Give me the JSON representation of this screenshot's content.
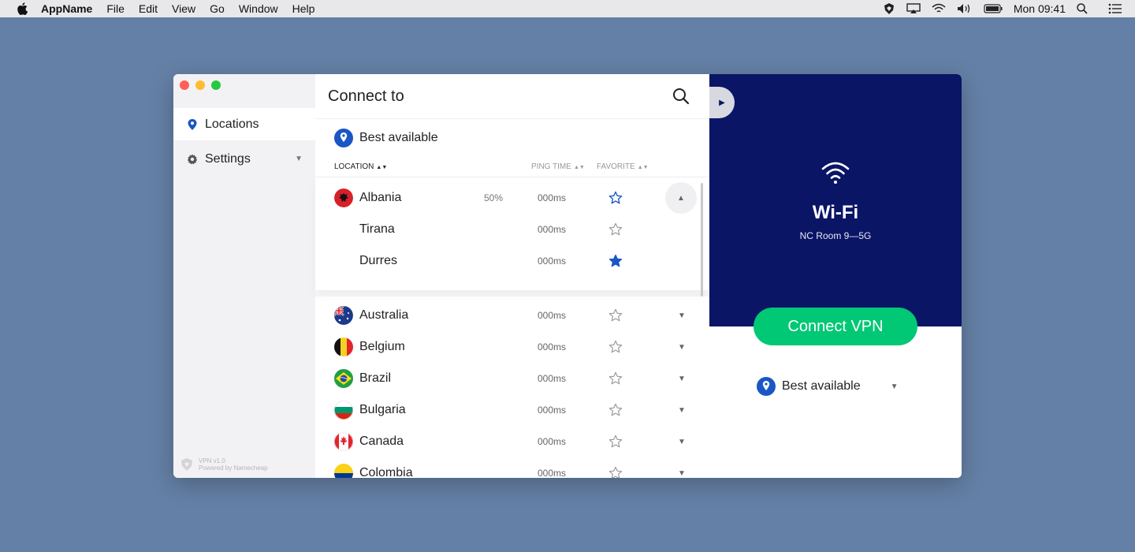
{
  "menubar": {
    "app_name": "AppName",
    "menus": [
      "File",
      "Edit",
      "View",
      "Go",
      "Window",
      "Help"
    ],
    "clock": "Mon 09:41"
  },
  "sidebar": {
    "items": [
      {
        "label": "Locations",
        "icon": "location-pin-icon",
        "active": true
      },
      {
        "label": "Settings",
        "icon": "gear-icon",
        "active": false
      }
    ],
    "brand_line1": "VPN v1.0",
    "brand_line2": "Powered by Namecheap"
  },
  "main": {
    "title": "Connect to",
    "best_available": "Best available",
    "columns": {
      "location": "LOCATION",
      "ping": "PING TIME",
      "favorite": "FAVORITE"
    },
    "expanded_country": {
      "name": "Albania",
      "load": "50%",
      "ping": "000ms",
      "favorite": false,
      "cities": [
        {
          "name": "Tirana",
          "ping": "000ms",
          "favorite": false
        },
        {
          "name": "Durres",
          "ping": "000ms",
          "favorite": true
        }
      ]
    },
    "countries": [
      {
        "name": "Australia",
        "ping": "000ms",
        "favorite": false
      },
      {
        "name": "Belgium",
        "ping": "000ms",
        "favorite": false
      },
      {
        "name": "Brazil",
        "ping": "000ms",
        "favorite": false
      },
      {
        "name": "Bulgaria",
        "ping": "000ms",
        "favorite": false
      },
      {
        "name": "Canada",
        "ping": "000ms",
        "favorite": false
      },
      {
        "name": "Colombia",
        "ping": "000ms",
        "favorite": false
      }
    ]
  },
  "panel": {
    "network_name": "Wi-Fi",
    "network_sub": "NC Room 9—5G",
    "connect_label": "Connect VPN",
    "selected_location": "Best available"
  },
  "colors": {
    "accent_blue": "#0a1566",
    "connect_green": "#00c875",
    "star_blue": "#1a56c4"
  }
}
